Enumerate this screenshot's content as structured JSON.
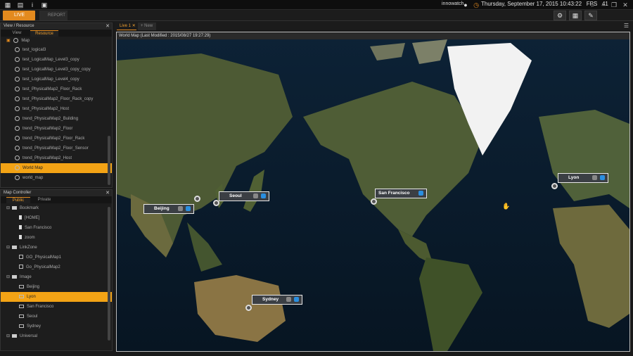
{
  "topbar": {
    "user": "innowatch",
    "datetime": "Thursday, September 17, 2015 10:43:22",
    "fps_label": "FPS",
    "fps_value": "41"
  },
  "modes": {
    "live": "LIVE",
    "report": "REPORT"
  },
  "view_resource": {
    "title": "View / Resource",
    "tabs": [
      "View",
      "Resource"
    ],
    "root": "Map",
    "items": [
      "test_logical3",
      "test_LogicalMap_Level3_copy",
      "test_LogicalMap_Level3_copy_copy",
      "test_LogicalMap_Level4_copy",
      "test_PhysicalMap2_Floor_Rack",
      "test_PhysicalMap2_Floor_Rack_copy",
      "test_PhysicalMap2_Host",
      "trend_PhysicalMap2_Building",
      "trend_PhysicalMap2_Floor",
      "trend_PhysicalMap2_Floor_Rack",
      "trend_PhysicalMap2_Floor_Sensor",
      "trend_PhysicalMap2_Host",
      "World Map",
      "world_map"
    ],
    "selected": "World Map"
  },
  "map_controller": {
    "title": "Map Controller",
    "tabs": [
      "Public",
      "Private"
    ],
    "groups": [
      {
        "name": "Bookmark",
        "items": [
          "[HOME]",
          "San Francisco",
          "zoom"
        ]
      },
      {
        "name": "LinkZone",
        "items": [
          "GO_PhysicalMap1",
          "Go_PhysicalMap2"
        ]
      },
      {
        "name": "Image",
        "items": [
          "Beijing",
          "Lyon",
          "San Francisco",
          "Seoul",
          "Sydney"
        ]
      },
      {
        "name": "Universal",
        "items": []
      }
    ],
    "selected": "Lyon"
  },
  "view_tabs": {
    "active": "Live 1",
    "new": "+ New"
  },
  "map": {
    "title": "World Map (Last Modified : 2015/08/27 19:27:29)",
    "markers": [
      "Seoul",
      "Beijing",
      "San Francisco",
      "Lyon",
      "Sydney"
    ]
  },
  "colors": {
    "accent": "#e38a1e",
    "selected": "#f3a315",
    "ocean": "#0b1e33",
    "land": "#5a6a3a"
  }
}
